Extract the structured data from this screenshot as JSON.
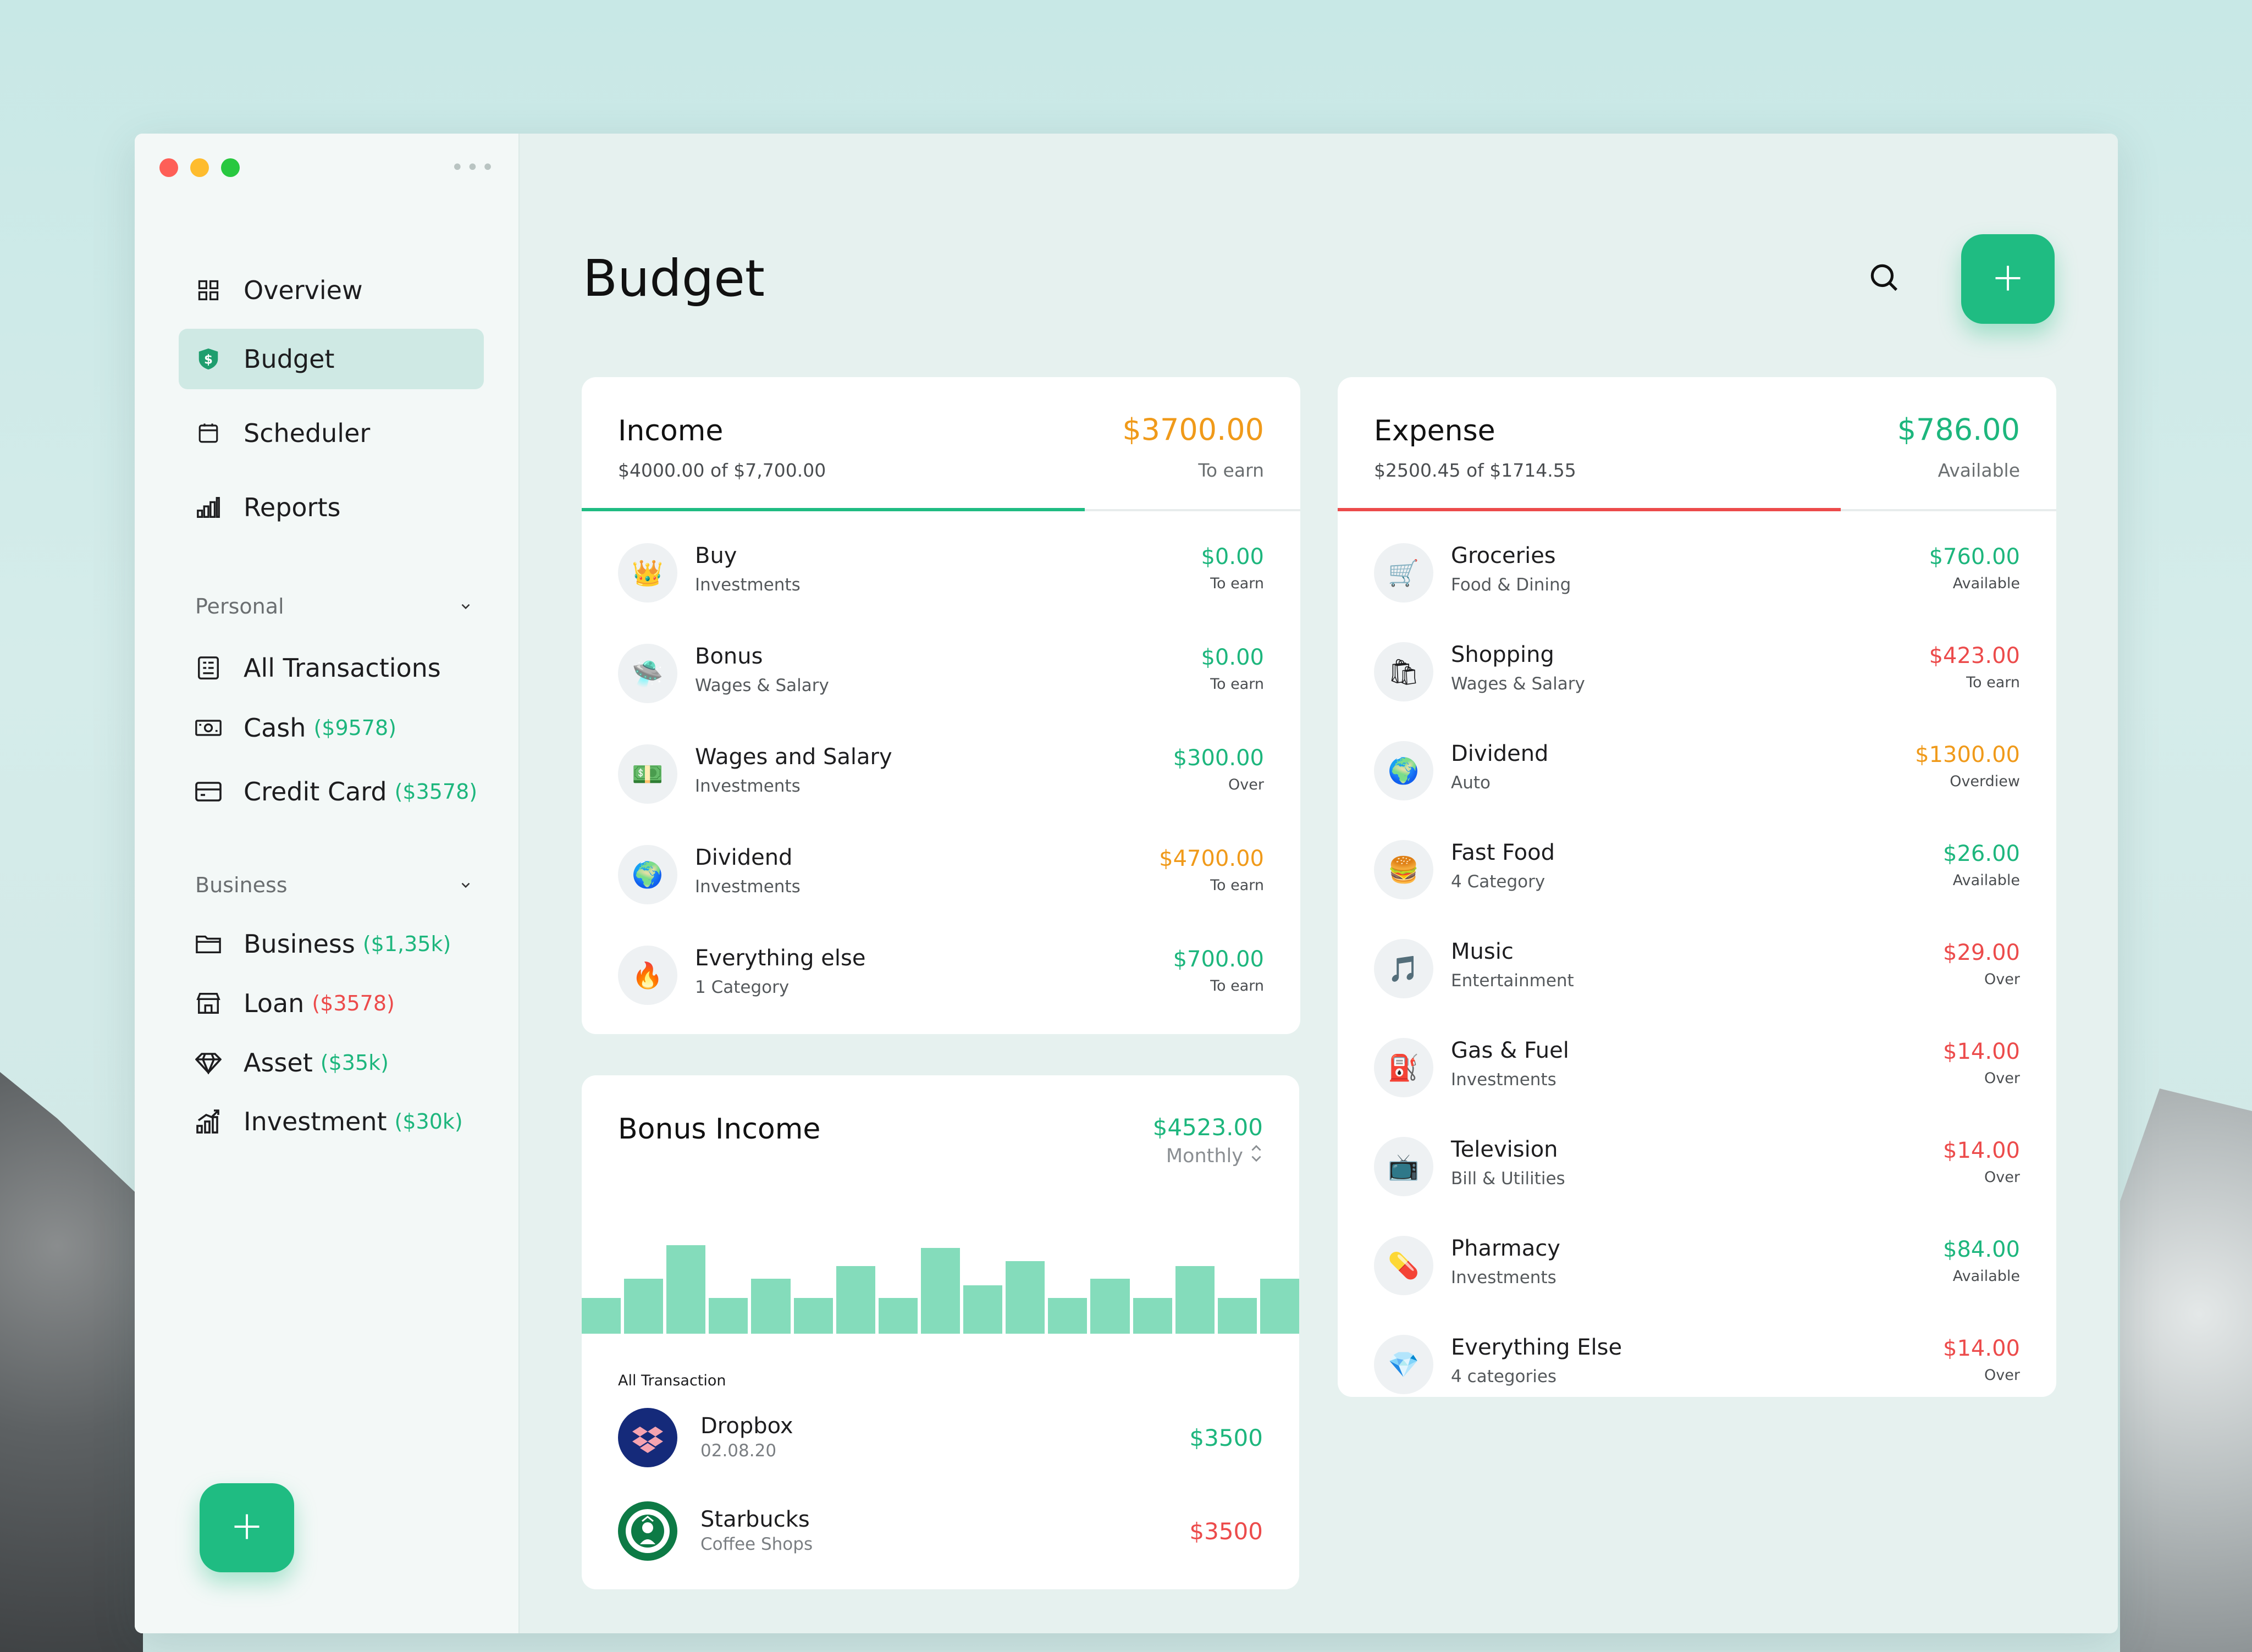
{
  "colors": {
    "accent": "#1fbc82",
    "orange": "#f09a1a",
    "red": "#ec4b4b",
    "green": "#1db67d"
  },
  "sidebar": {
    "nav": [
      {
        "label": "Overview",
        "icon": "grid-icon"
      },
      {
        "label": "Budget",
        "icon": "shield-dollar-icon"
      },
      {
        "label": "Scheduler",
        "icon": "calendar-icon"
      },
      {
        "label": "Reports",
        "icon": "bar-chart-icon"
      }
    ],
    "personal": {
      "label": "Personal",
      "items": [
        {
          "label": "All Transactions",
          "amount": ""
        },
        {
          "label": "Cash",
          "amount": "($9578)"
        },
        {
          "label": "Credit Card",
          "amount": "($3578)"
        }
      ]
    },
    "business": {
      "label": "Business",
      "items": [
        {
          "label": "Business",
          "amount": "($1,35k)"
        },
        {
          "label": "Loan",
          "amount": "($3578)"
        },
        {
          "label": "Asset",
          "amount": "($35k)"
        },
        {
          "label": "Investment",
          "amount": "($30k)"
        }
      ]
    }
  },
  "header": {
    "title": "Budget"
  },
  "income": {
    "title": "Income",
    "subtitle": "$4000.00 of $7,700.00",
    "amount": "$3700.00",
    "status": "To earn",
    "progress": 0.7,
    "rows": [
      {
        "name": "Buy",
        "category": "Investments",
        "value": "$0.00",
        "status": "To earn",
        "icon": "👑",
        "color": "green"
      },
      {
        "name": "Bonus",
        "category": "Wages & Salary",
        "value": "$0.00",
        "status": "To earn",
        "icon": "🛸",
        "color": "green"
      },
      {
        "name": "Wages and Salary",
        "category": "Investments",
        "value": "$300.00",
        "status": "Over",
        "icon": "💵",
        "color": "green"
      },
      {
        "name": "Dividend",
        "category": "Investments",
        "value": "$4700.00",
        "status": "To earn",
        "icon": "🌍",
        "color": "orange"
      },
      {
        "name": "Everything else",
        "category": "1 Category",
        "value": "$700.00",
        "status": "To earn",
        "icon": "🔥",
        "color": "green"
      }
    ]
  },
  "bonus": {
    "title": "Bonus Income",
    "amount": "$4523.00",
    "period": "Monthly",
    "bars": [
      0.22,
      0.34,
      0.55,
      0.22,
      0.34,
      0.22,
      0.42,
      0.22,
      0.53,
      0.3,
      0.45,
      0.22,
      0.34,
      0.22,
      0.42,
      0.22,
      0.34
    ],
    "transactions_label": "All Transaction",
    "transactions": [
      {
        "name": "Dropbox",
        "sub": "02.08.20",
        "value": "$3500",
        "color": "green",
        "icon": "dropbox-logo-icon"
      },
      {
        "name": "Starbucks",
        "sub": "Coffee Shops",
        "value": "$3500",
        "color": "red",
        "icon": "starbucks-logo-icon"
      }
    ]
  },
  "expense": {
    "title": "Expense",
    "subtitle": "$2500.45 of $1714.55",
    "amount": "$786.00",
    "status": "Available",
    "progress": 0.7,
    "rows": [
      {
        "name": "Groceries",
        "category": "Food & Dining",
        "value": "$760.00",
        "status": "Available",
        "icon": "🛒",
        "color": "green"
      },
      {
        "name": "Shopping",
        "category": "Wages & Salary",
        "value": "$423.00",
        "status": "To earn",
        "icon": "🛍",
        "color": "red"
      },
      {
        "name": "Dividend",
        "category": "Auto",
        "value": "$1300.00",
        "status": "Overdiew",
        "icon": "🌍",
        "color": "orange"
      },
      {
        "name": "Fast Food",
        "category": "4 Category",
        "value": "$26.00",
        "status": "Available",
        "icon": "🍔",
        "color": "green"
      },
      {
        "name": "Music",
        "category": "Entertainment",
        "value": "$29.00",
        "status": "Over",
        "icon": "🎵",
        "color": "red"
      },
      {
        "name": "Gas & Fuel",
        "category": "Investments",
        "value": "$14.00",
        "status": "Over",
        "icon": "⛽",
        "color": "red"
      },
      {
        "name": "Television",
        "category": "Bill & Utilities",
        "value": "$14.00",
        "status": "Over",
        "icon": "📺",
        "color": "red"
      },
      {
        "name": "Pharmacy",
        "category": "Investments",
        "value": "$84.00",
        "status": "Available",
        "icon": "💊",
        "color": "green"
      },
      {
        "name": "Everything Else",
        "category": "4 categories",
        "value": "$14.00",
        "status": "Over",
        "icon": "💎",
        "color": "red"
      }
    ]
  }
}
